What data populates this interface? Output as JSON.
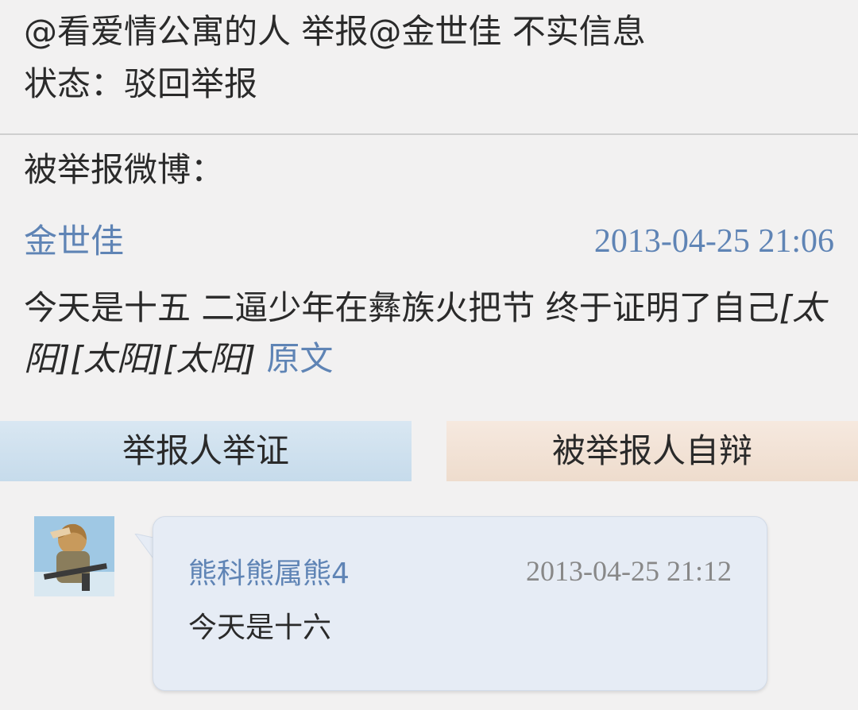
{
  "report": {
    "title": "@看爱情公寓的人 举报@金世佳 不实信息",
    "status_label": "状态：",
    "status_value": "驳回举报"
  },
  "reported_section": {
    "label": "被举报微博："
  },
  "weibo": {
    "author": "金世佳",
    "time": "2013-04-25 21:06",
    "text": "今天是十五 二逼少年在彝族火把节 终于证明了自己",
    "emojis": [
      "[太阳]",
      "[太阳]",
      "[太阳]"
    ],
    "original_link": "原文"
  },
  "tabs": {
    "reporter_evidence": "举报人举证",
    "reported_defense": "被举报人自辩"
  },
  "reply": {
    "author": "熊科熊属熊4",
    "time": "2013-04-25 21:12",
    "text": "今天是十六"
  },
  "colors": {
    "link": "#5f84b5",
    "tab_left": "#cfe0ee",
    "tab_right": "#f2e2d5",
    "bubble": "#e6ecf5"
  }
}
